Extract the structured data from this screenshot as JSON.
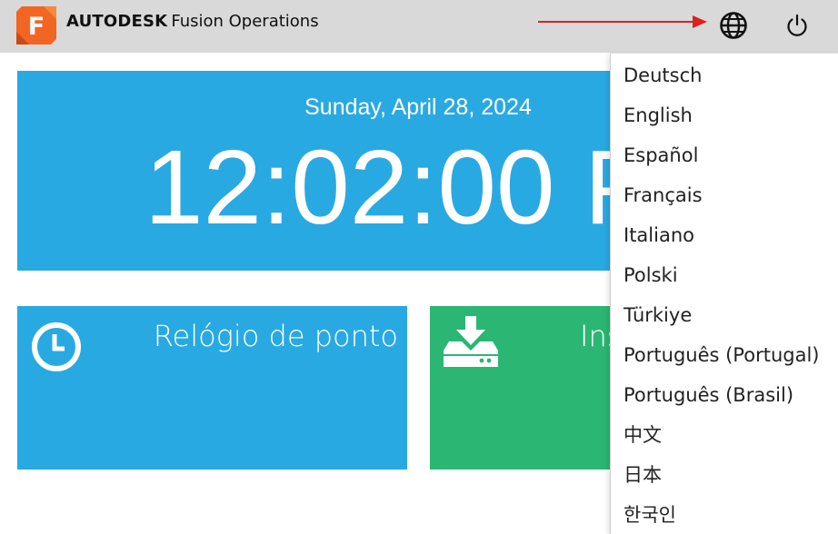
{
  "header": {
    "brand_bold": "AUTODESK",
    "brand_product": "Fusion Operations",
    "logo_letter": "F",
    "globe_icon": "globe-icon",
    "power_icon": "power-icon",
    "annotation_arrow_color": "#e02020"
  },
  "clock": {
    "date": "Sunday, April 28, 2024",
    "time": "12:02:00 P"
  },
  "tiles": {
    "punch": {
      "label": "Relógio de ponto",
      "icon": "clock-icon",
      "color": "#29a9e1"
    },
    "install": {
      "label": "Ins",
      "icon": "download-icon",
      "color": "#2bb673"
    }
  },
  "language_menu": {
    "items": [
      "Deutsch",
      "English",
      "Español",
      "Français",
      "Italiano",
      "Polski",
      "Türkiye",
      "Português (Portugal)",
      "Português (Brasil)",
      "中文",
      "日本",
      "한국인"
    ]
  },
  "colors": {
    "header_bg": "#d9d9d9",
    "tile_blue": "#29a9e1",
    "tile_green": "#2bb673",
    "logo_orange": "#f26522"
  }
}
